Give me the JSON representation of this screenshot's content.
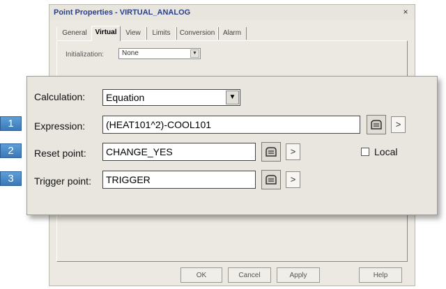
{
  "window": {
    "title": "Point Properties - VIRTUAL_ANALOG",
    "close": "×"
  },
  "tabs": [
    {
      "label": "General"
    },
    {
      "label": "Virtual"
    },
    {
      "label": "View"
    },
    {
      "label": "Limits"
    },
    {
      "label": "Conversion"
    },
    {
      "label": "Alarm"
    }
  ],
  "active_tab": "Virtual",
  "initialization": {
    "label": "Initialization:",
    "value": "None"
  },
  "panel": {
    "calculation": {
      "label": "Calculation:",
      "value": "Equation"
    },
    "expression": {
      "label": "Expression:",
      "value": "(HEAT101^2)-COOL101",
      "badge": "1"
    },
    "reset_point": {
      "label": "Reset point:",
      "value": "CHANGE_YES",
      "badge": "2"
    },
    "trigger_point": {
      "label": "Trigger point:",
      "value": "TRIGGER",
      "badge": "3"
    },
    "local": {
      "label": "Local",
      "checked": false
    },
    "arrow_label": ">"
  },
  "footer": {
    "ok": "OK",
    "cancel": "Cancel",
    "apply": "Apply",
    "help": "Help"
  },
  "colors": {
    "badge": "#3f80c1",
    "title_text": "#2a3f8a",
    "dialog_bg": "#ece9e2"
  }
}
